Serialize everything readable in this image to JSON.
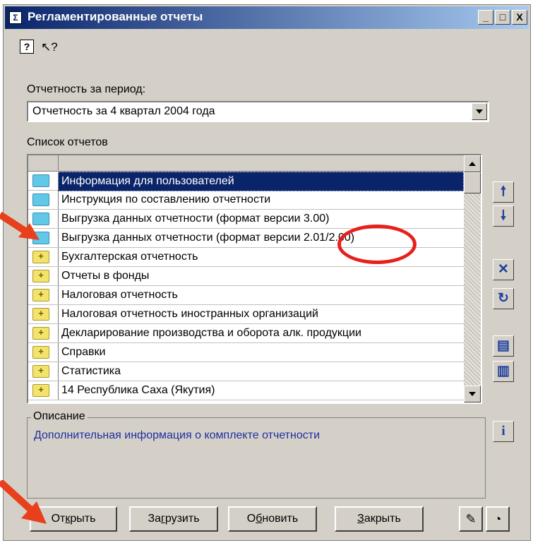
{
  "window": {
    "title": "Регламентированные отчеты",
    "title_icon_glyph": "Σ",
    "controls": [
      "_",
      "□",
      "X"
    ]
  },
  "toolbar": {
    "help_glyph": "?",
    "whats_this_glyph": "↖?"
  },
  "period": {
    "label": "Отчетность за период:",
    "value": "Отчетность за 4 квартал 2004 года"
  },
  "reports": {
    "label": "Список отчетов",
    "items": [
      {
        "text": "Информация для пользователей",
        "icon": "folder-blue",
        "selected": true
      },
      {
        "text": "Инструкция по составлению отчетности",
        "icon": "folder-blue",
        "selected": false
      },
      {
        "text": "Выгрузка данных отчетности (формат версии 3.00)",
        "icon": "folder-blue",
        "selected": false
      },
      {
        "text": "Выгрузка данных отчетности (формат версии 2.01/2.00)",
        "icon": "folder-blue",
        "selected": false
      },
      {
        "text": "Бухгалтерская отчетность",
        "icon": "folder-yellow-plus",
        "selected": false
      },
      {
        "text": "Отчеты в фонды",
        "icon": "folder-yellow-plus",
        "selected": false
      },
      {
        "text": "Налоговая отчетность",
        "icon": "folder-yellow-plus",
        "selected": false
      },
      {
        "text": "Налоговая отчетность иностранных организаций",
        "icon": "folder-yellow-plus",
        "selected": false
      },
      {
        "text": "Декларирование производства и оборота алк. продукции",
        "icon": "folder-yellow-plus",
        "selected": false
      },
      {
        "text": "Справки",
        "icon": "folder-yellow-plus",
        "selected": false
      },
      {
        "text": "Статистика",
        "icon": "folder-yellow-plus",
        "selected": false
      },
      {
        "text": "14 Республика Саха (Якутия)",
        "icon": "folder-yellow-plus",
        "selected": false
      }
    ]
  },
  "side_buttons": {
    "move_up": "🠕",
    "move_down": "🠗",
    "delete": "✕",
    "refresh": "↻",
    "save": "▤",
    "load": "▥",
    "info": "i"
  },
  "description": {
    "legend": "Описание",
    "text": "Дополнительная информация о комплекте отчетности"
  },
  "buttons": {
    "open": {
      "pre": "От",
      "u": "к",
      "post": "рыть"
    },
    "load": {
      "pre": "За",
      "u": "г",
      "post": "рузить"
    },
    "refresh": {
      "pre": "О",
      "u": "б",
      "post": "новить"
    },
    "close": {
      "pre": "",
      "u": "З",
      "post": "акрыть"
    },
    "extra1_glyph": "✎",
    "extra2_glyph": "◔"
  },
  "colors": {
    "title_bar": "#0a246a",
    "selection": "#0a246a",
    "annotation": "#e8201c",
    "description_text": "#1f2ea0"
  }
}
